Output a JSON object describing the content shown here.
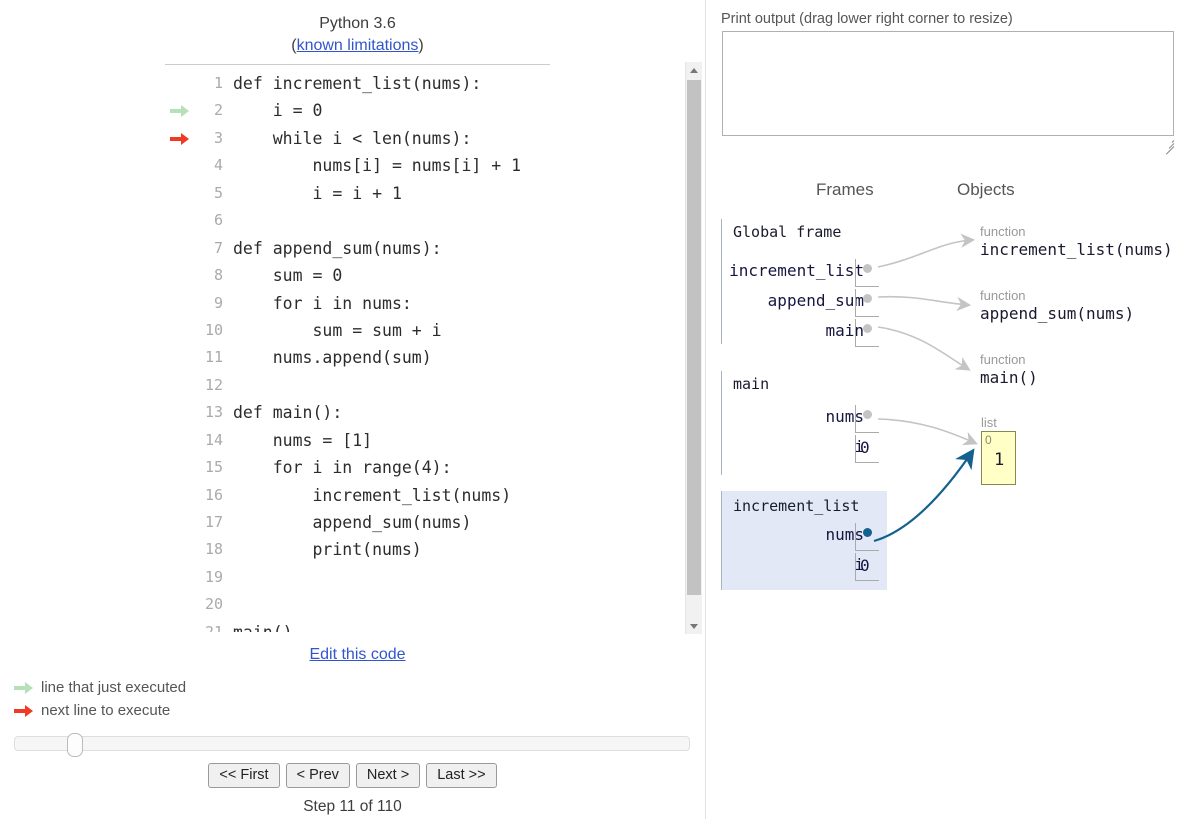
{
  "left": {
    "python_version": "Python 3.6",
    "limitations_prefix": "(",
    "limitations_link": "known limitations",
    "limitations_suffix": ")",
    "edit_code_link": "Edit this code",
    "code_lines": [
      {
        "num": "1",
        "text": "def increment_list(nums):",
        "arrow": "none"
      },
      {
        "num": "2",
        "text": "    i = 0",
        "arrow": "executed"
      },
      {
        "num": "3",
        "text": "    while i < len(nums):",
        "arrow": "next"
      },
      {
        "num": "4",
        "text": "        nums[i] = nums[i] + 1",
        "arrow": "none"
      },
      {
        "num": "5",
        "text": "        i = i + 1",
        "arrow": "none"
      },
      {
        "num": "6",
        "text": "",
        "arrow": "none"
      },
      {
        "num": "7",
        "text": "def append_sum(nums):",
        "arrow": "none"
      },
      {
        "num": "8",
        "text": "    sum = 0",
        "arrow": "none"
      },
      {
        "num": "9",
        "text": "    for i in nums:",
        "arrow": "none"
      },
      {
        "num": "10",
        "text": "        sum = sum + i",
        "arrow": "none"
      },
      {
        "num": "11",
        "text": "    nums.append(sum)",
        "arrow": "none"
      },
      {
        "num": "12",
        "text": "",
        "arrow": "none"
      },
      {
        "num": "13",
        "text": "def main():",
        "arrow": "none"
      },
      {
        "num": "14",
        "text": "    nums = [1]",
        "arrow": "none"
      },
      {
        "num": "15",
        "text": "    for i in range(4):",
        "arrow": "none"
      },
      {
        "num": "16",
        "text": "        increment_list(nums)",
        "arrow": "none"
      },
      {
        "num": "17",
        "text": "        append_sum(nums)",
        "arrow": "none"
      },
      {
        "num": "18",
        "text": "        print(nums)",
        "arrow": "none"
      },
      {
        "num": "19",
        "text": "",
        "arrow": "none"
      },
      {
        "num": "20",
        "text": "",
        "arrow": "none"
      },
      {
        "num": "21",
        "text": "main()",
        "arrow": "none"
      }
    ],
    "legend": {
      "executed": "line that just executed",
      "next": "next line to execute"
    },
    "nav": {
      "first": "<< First",
      "prev": "< Prev",
      "next": "Next >",
      "last": "Last >>"
    },
    "step_counter": "Step 11 of 110"
  },
  "right": {
    "print_output_label": "Print output (drag lower right corner to resize)",
    "print_output_value": "",
    "frames_heading": "Frames",
    "objects_heading": "Objects",
    "frames": [
      {
        "title": "Global frame",
        "highlighted": false,
        "vars": [
          {
            "name": "increment_list",
            "value": "",
            "is_pointer": true
          },
          {
            "name": "append_sum",
            "value": "",
            "is_pointer": true
          },
          {
            "name": "main",
            "value": "",
            "is_pointer": true
          }
        ]
      },
      {
        "title": "main",
        "highlighted": false,
        "vars": [
          {
            "name": "nums",
            "value": "",
            "is_pointer": true
          },
          {
            "name": "i",
            "value": "0",
            "is_pointer": false
          }
        ]
      },
      {
        "title": "increment_list",
        "highlighted": true,
        "vars": [
          {
            "name": "nums",
            "value": "",
            "is_pointer": true
          },
          {
            "name": "i",
            "value": "0",
            "is_pointer": false
          }
        ]
      }
    ],
    "objects": [
      {
        "type": "function",
        "label": "increment_list(nums)"
      },
      {
        "type": "function",
        "label": "append_sum(nums)"
      },
      {
        "type": "function",
        "label": "main()"
      }
    ],
    "list_object": {
      "type": "list",
      "indices": [
        "0"
      ],
      "values": [
        "1"
      ]
    }
  },
  "colors": {
    "arrow_executed": "#b6e0b6",
    "arrow_next": "#ef3b24",
    "frame_highlight_bg": "#e2e8f5",
    "list_bg": "#ffffc6",
    "link": "#3355cc",
    "pointer_blue": "#14618f",
    "pointer_grey": "#c4c4c4"
  }
}
